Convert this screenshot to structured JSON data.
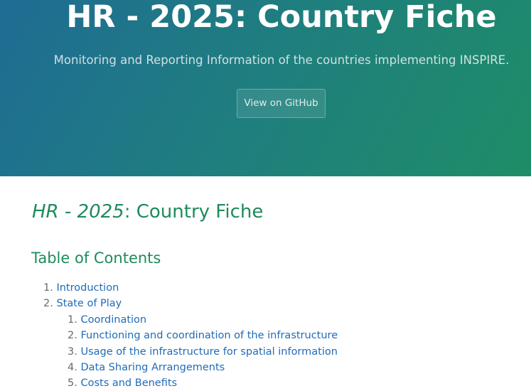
{
  "header": {
    "title": "HR - 2025: Country Fiche",
    "tagline": "Monitoring and Reporting Information of the countries implementing INSPIRE.",
    "github_button": "View on GitHub"
  },
  "content": {
    "heading": {
      "code": "HR",
      "separator": " - ",
      "year": "2025",
      "rest": ": Country Fiche"
    },
    "toc_title": "Table of Contents",
    "toc": [
      {
        "number": "1.",
        "label": "Introduction"
      },
      {
        "number": "2.",
        "label": "State of Play",
        "children": [
          {
            "number": "1.",
            "label": "Coordination"
          },
          {
            "number": "2.",
            "label": "Functioning and coordination of the infrastructure"
          },
          {
            "number": "3.",
            "label": "Usage of the infrastructure for spatial information"
          },
          {
            "number": "4.",
            "label": "Data Sharing Arrangements"
          },
          {
            "number": "5.",
            "label": "Costs and Benefits"
          }
        ]
      }
    ]
  }
}
